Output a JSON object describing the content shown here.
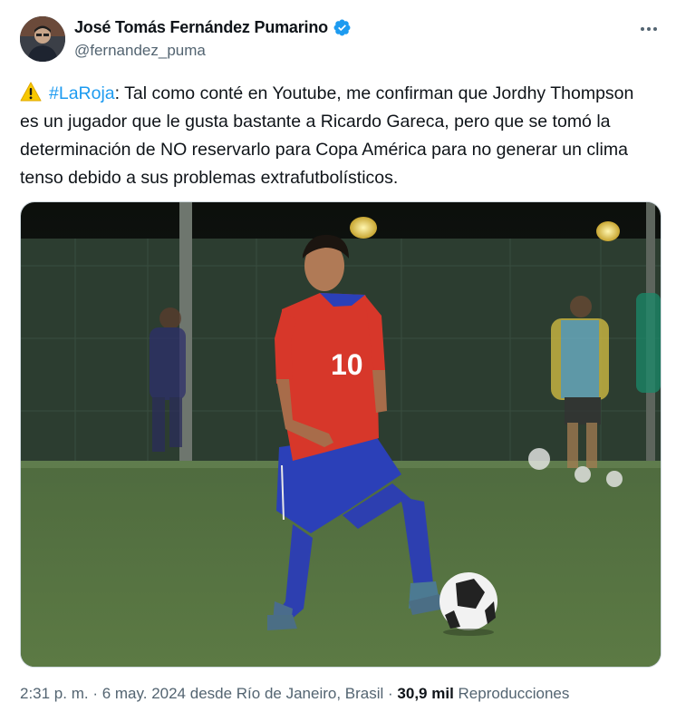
{
  "author": {
    "display_name": "José Tomás Fernández Pumarino",
    "handle": "@fernandez_puma",
    "verified": true,
    "verified_color": "#1d9bf0"
  },
  "more_icon": "ellipsis-icon",
  "tweet": {
    "warning_icon": "warning-icon",
    "hashtag": "#LaRoja",
    "text": ": Tal como conté en Youtube, me confirman que Jordhy Thompson es un jugador que le gusta bastante a Ricardo Gareca, pero que se tomó la determinación de NO reservarlo para Copa América para no generar un clima tenso debido a sus problemas extrafutbolísticos."
  },
  "media": {
    "jersey_number": "10"
  },
  "footer": {
    "time": "2:31 p. m.",
    "separator": " · ",
    "date": "6 may. 2024",
    "location_prefix": " desde ",
    "location": "Río de Janeiro, Brasil",
    "views_count": "30,9 mil",
    "views_label": "Reproducciones"
  },
  "colors": {
    "link": "#1d9bf0",
    "secondary_text": "#536471",
    "primary_text": "#0f1419"
  }
}
